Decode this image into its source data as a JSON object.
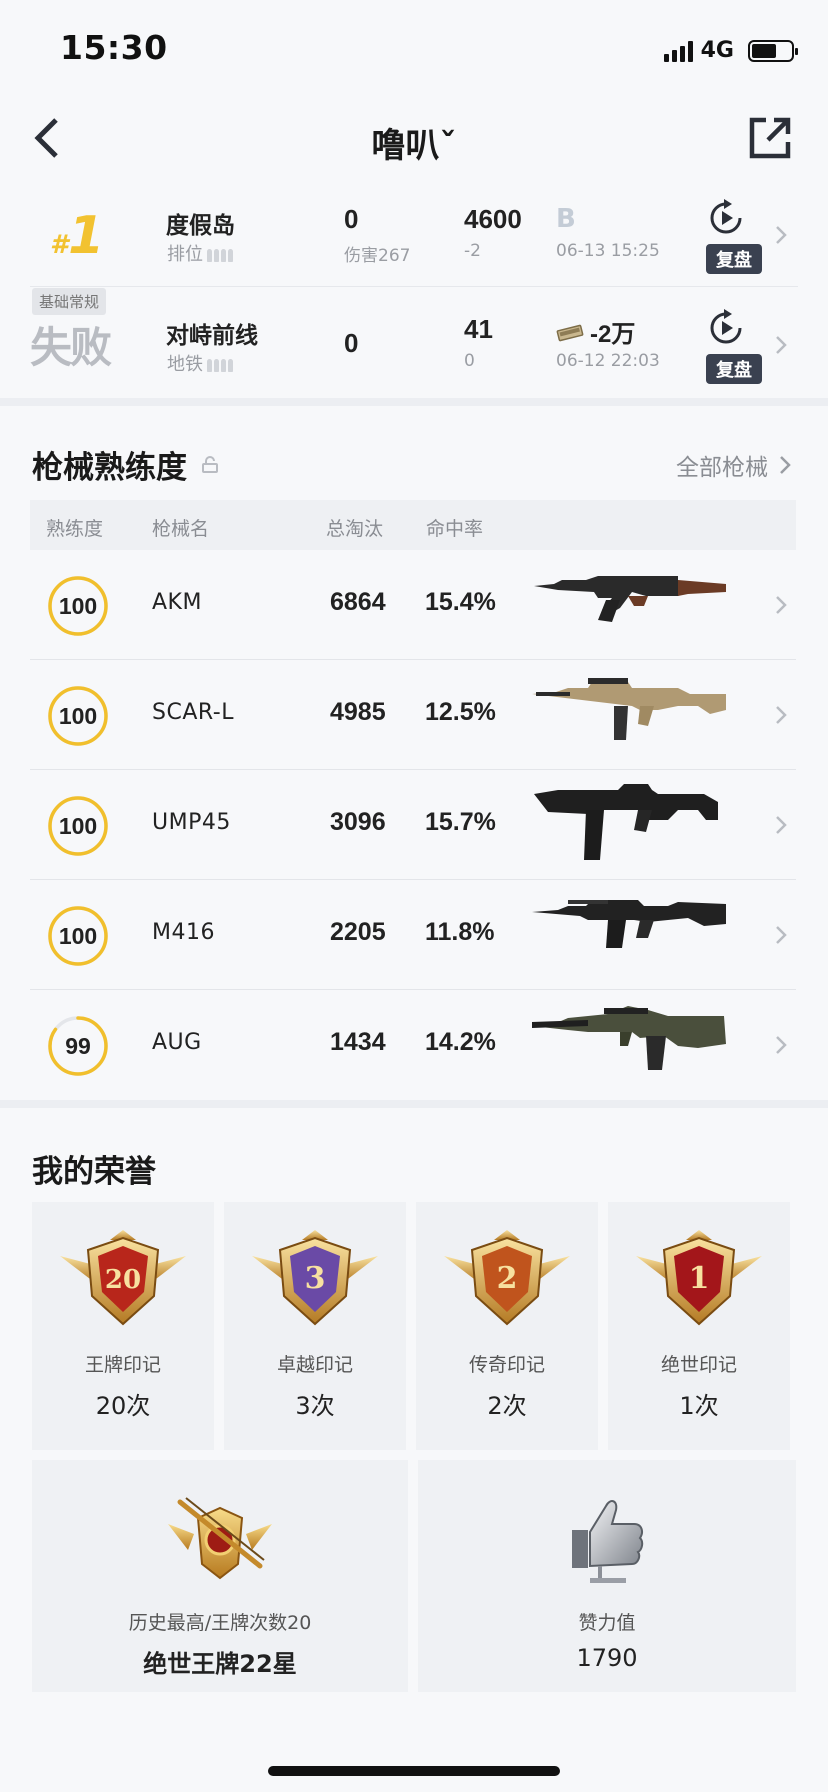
{
  "status_bar": {
    "time": "15:30",
    "network": "4G",
    "battery_fraction": 0.62
  },
  "header": {
    "title": "噜叭ˇ"
  },
  "matches": [
    {
      "rank": "1",
      "rank_prefix": "#",
      "map": "度假岛",
      "mode": "排位",
      "kills": "0",
      "damage": "伤害267",
      "score": "4600",
      "score_change": "-2",
      "grade": "B",
      "time": "06-13 15:25",
      "replay_label": "复盘"
    },
    {
      "badge": "基础常规",
      "result": "失败",
      "map": "对峙前线",
      "mode": "地铁",
      "kills": "0",
      "score": "41",
      "score_change": "0",
      "reward": "-2万",
      "time": "06-12 22:03",
      "replay_label": "复盘"
    }
  ],
  "weapons_section": {
    "title": "枪械熟练度",
    "all_link": "全部枪械",
    "columns": [
      "熟练度",
      "枪械名",
      "总淘汰",
      "命中率"
    ],
    "rows": [
      {
        "proficiency": "100",
        "level": 1.0,
        "name": "AKM",
        "kills": "6864",
        "accuracy": "15.4%"
      },
      {
        "proficiency": "100",
        "level": 1.0,
        "name": "SCAR-L",
        "kills": "4985",
        "accuracy": "12.5%"
      },
      {
        "proficiency": "100",
        "level": 1.0,
        "name": "UMP45",
        "kills": "3096",
        "accuracy": "15.7%"
      },
      {
        "proficiency": "100",
        "level": 1.0,
        "name": "M416",
        "kills": "2205",
        "accuracy": "11.8%"
      },
      {
        "proficiency": "99",
        "level": 0.85,
        "name": "AUG",
        "kills": "1434",
        "accuracy": "14.2%"
      }
    ]
  },
  "honors_section": {
    "title": "我的荣誉",
    "marks": [
      {
        "medal_num": "20",
        "name": "王牌印记",
        "count": "20次",
        "color": "#b8261b"
      },
      {
        "medal_num": "3",
        "name": "卓越印记",
        "count": "3次",
        "color": "#6a4aa6"
      },
      {
        "medal_num": "2",
        "name": "传奇印记",
        "count": "2次",
        "color": "#c0541d"
      },
      {
        "medal_num": "1",
        "name": "绝世印记",
        "count": "1次",
        "color": "#a3161a"
      }
    ],
    "highest": {
      "label": "历史最高/王牌次数20",
      "value": "绝世王牌22星"
    },
    "likes": {
      "label": "赞力值",
      "value": "1790"
    }
  }
}
